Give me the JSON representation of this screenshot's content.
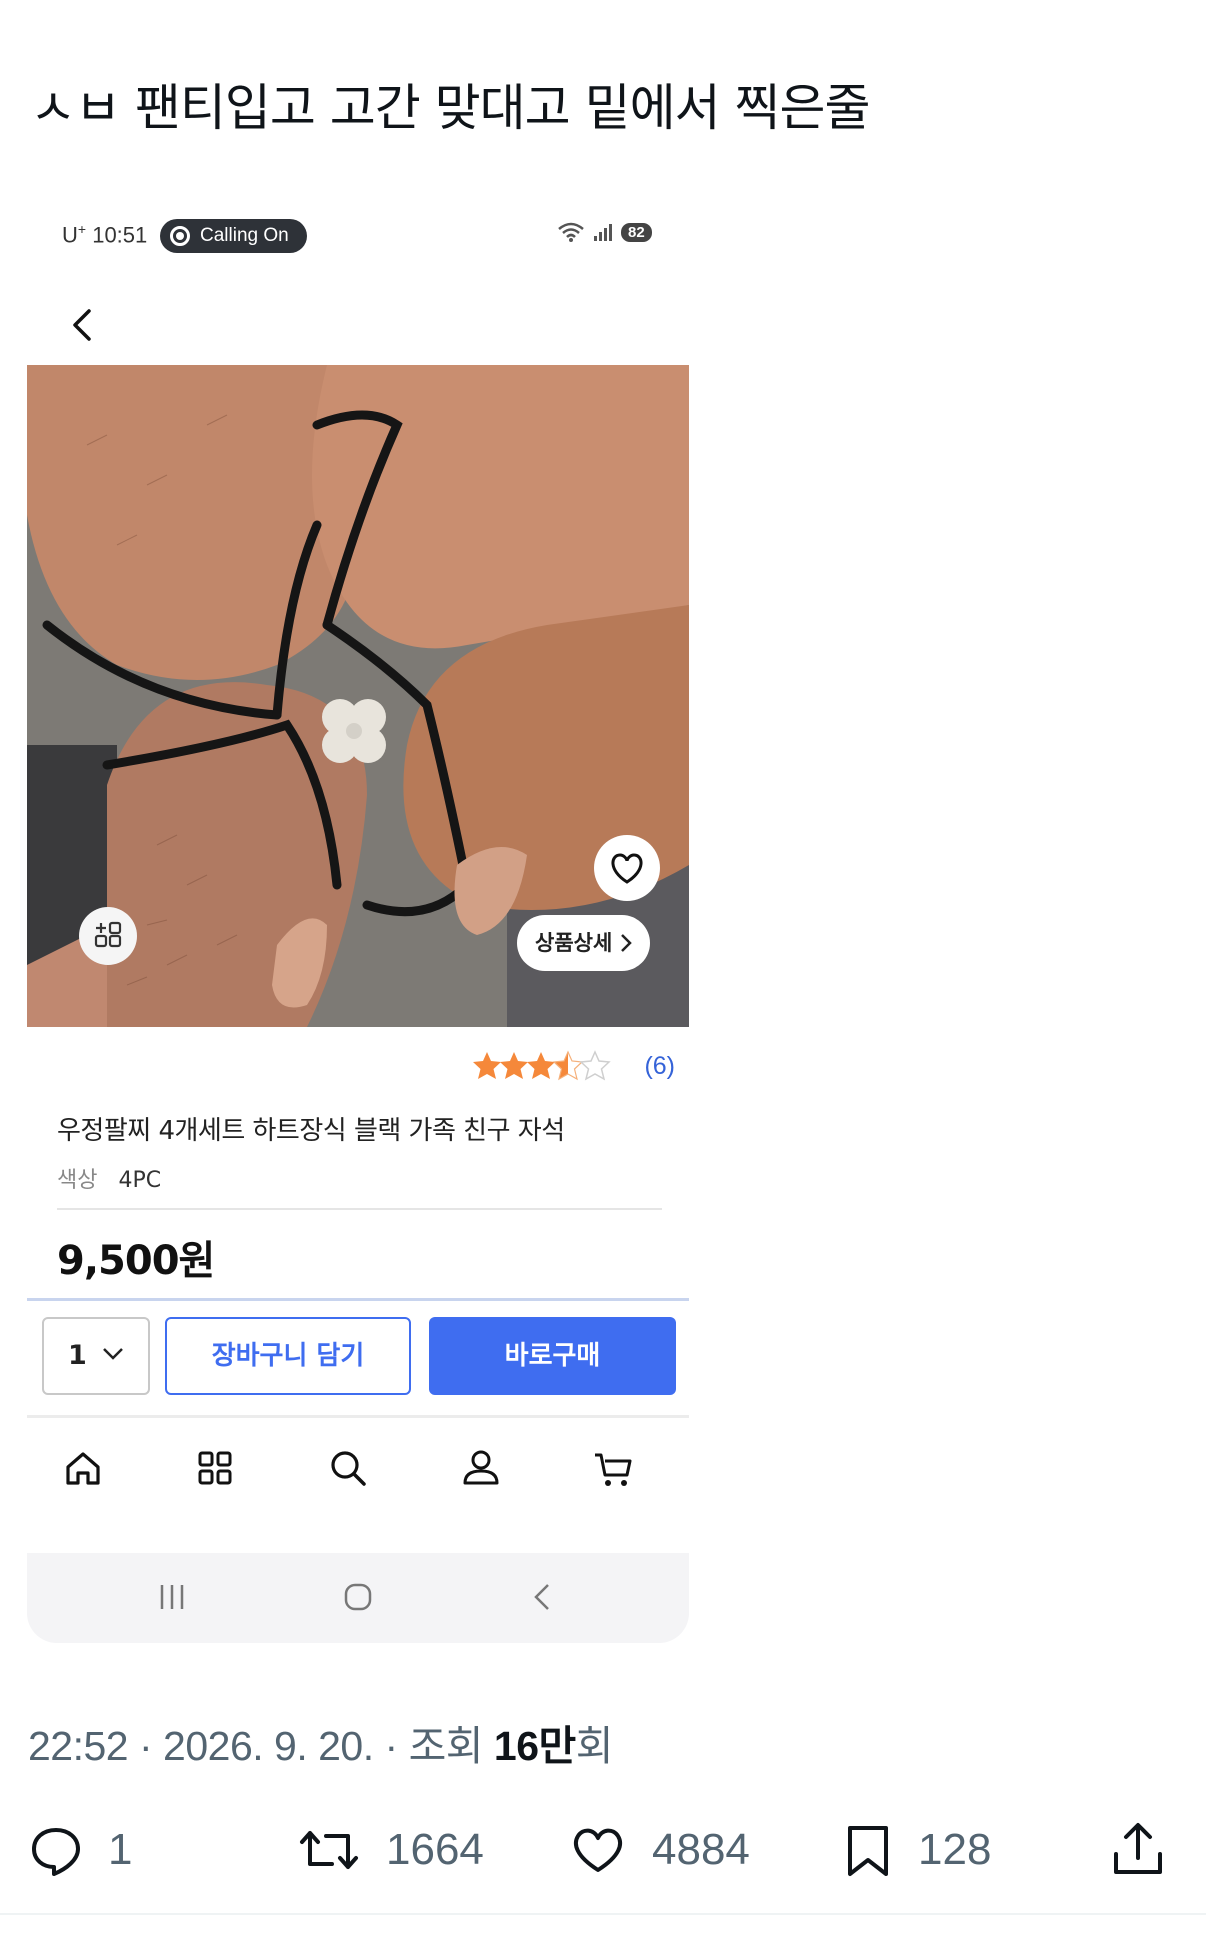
{
  "tweet": {
    "text": "ㅅㅂ 팬티입고 고간 맞대고 밑에서 찍은줄"
  },
  "screenshot": {
    "status_bar": {
      "carrier": "U",
      "carrier_sup": "+",
      "time": "10:51",
      "call_pill": "Calling On",
      "battery": "82"
    },
    "product": {
      "detail_button": "상품상세",
      "rating_stars": 3.5,
      "rating_max": 5,
      "review_count": "(6)",
      "name": "우정팔찌 4개세트 하트장식 블랙 가족 친구 자석",
      "option_label": "색상",
      "option_value": "4PC",
      "price": "9,500원"
    },
    "purchase_bar": {
      "quantity": "1",
      "cart_label": "장바구니 담기",
      "buy_label": "바로구매",
      "accent_color": "#3f6df0"
    },
    "bottom_nav": {
      "icons": [
        "home-icon",
        "category-grid-icon",
        "search-icon",
        "user-icon",
        "cart-icon"
      ]
    },
    "system_nav": {
      "icons": [
        "recent-apps-icon",
        "home-button-icon",
        "back-button-icon"
      ]
    }
  },
  "meta": {
    "time": "22:52",
    "date": "2026. 9. 20.",
    "views_prefix": "조회",
    "views_count": "16만",
    "views_suffix": "회"
  },
  "actions": {
    "replies": "1",
    "retweets": "1664",
    "likes": "4884",
    "bookmarks": "128"
  }
}
